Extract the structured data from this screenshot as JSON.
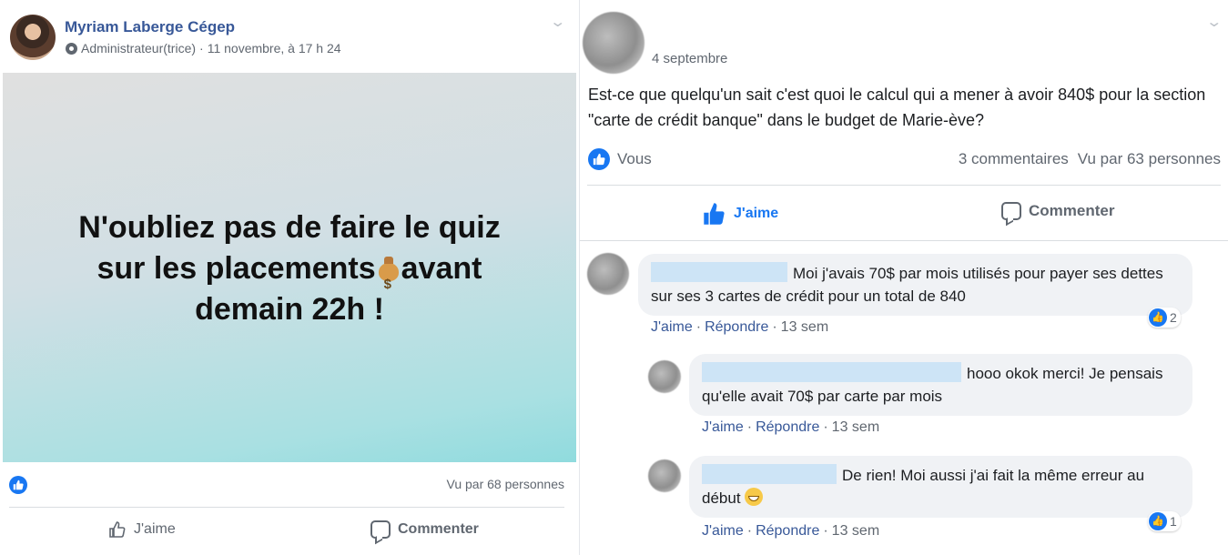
{
  "left_post": {
    "author": "Myriam Laberge Cégep",
    "role": "Administrateur(trice)",
    "separator": "·",
    "timestamp": "11 novembre, à 17 h 24",
    "banner": {
      "line1": "N'oubliez pas de faire le quiz",
      "line2_before": "sur les placements",
      "line2_after": "avant",
      "line3": "demain 22h !"
    },
    "views": "Vu par 68 personnes",
    "like_label": "J'aime",
    "comment_label": "Commenter"
  },
  "right_post": {
    "date": "4 septembre",
    "text": "Est-ce que quelqu'un sait c'est quoi le calcul qui a mener à avoir 840$ pour la section \"carte de crédit banque\" dans le budget de Marie-ève?",
    "reactors": "Vous",
    "comments_count": "3 commentaires",
    "views": "Vu par 63 personnes",
    "like_label": "J'aime",
    "comment_label": "Commenter",
    "comments": [
      {
        "text": "Moi j'avais 70$ par mois utilisés pour payer ses dettes sur ses 3 cartes de crédit pour un total de 840",
        "like": "J'aime",
        "reply": "Répondre",
        "time": "13 sem",
        "reactions": "2"
      },
      {
        "text": "hooo okok merci! Je pensais qu'elle avait 70$ par carte par mois",
        "like": "J'aime",
        "reply": "Répondre",
        "time": "13 sem"
      },
      {
        "text": "De rien! Moi aussi j'ai fait la même erreur au début",
        "like": "J'aime",
        "reply": "Répondre",
        "time": "13 sem",
        "reactions": "1"
      }
    ]
  },
  "icons": {
    "like": "thumbs-up-icon",
    "comment": "speech-bubble-icon",
    "admin": "admin-shield-icon",
    "money": "money-bag-icon",
    "emoji": "grinning-face-icon",
    "menu": "chevron-down-icon"
  },
  "colors": {
    "link": "#385898",
    "like_blue": "#1877f2",
    "muted": "#606770",
    "bubble": "#f0f2f5"
  }
}
